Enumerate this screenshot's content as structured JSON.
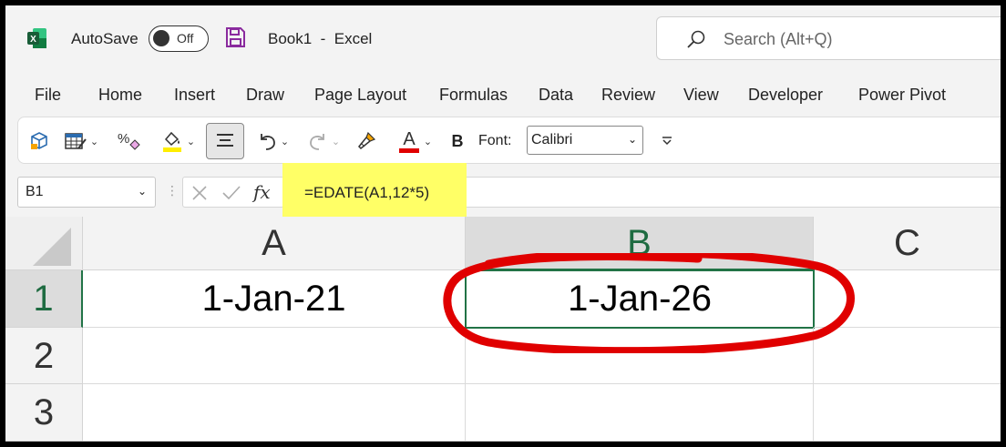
{
  "title_bar": {
    "autosave_label": "AutoSave",
    "autosave_state": "Off",
    "document_title": "Book1  -  Excel",
    "search_placeholder": "Search (Alt+Q)"
  },
  "menu": {
    "items": [
      "File",
      "Home",
      "Insert",
      "Draw",
      "Page Layout",
      "Formulas",
      "Data",
      "Review",
      "View",
      "Developer",
      "Power Pivot"
    ]
  },
  "ribbon": {
    "font_label": "Font:",
    "font_value": "Calibri",
    "bold_label": "B",
    "font_color_letter": "A",
    "icons": [
      "3d-models-icon",
      "format-as-table-icon",
      "percent-style-icon",
      "fill-color-icon",
      "align-center-icon",
      "undo-icon",
      "redo-icon",
      "format-painter-icon",
      "font-color-icon",
      "bold-icon",
      "customize-toolbar-icon"
    ],
    "colors": {
      "fill_color_bar": "#ffee00",
      "font_color_bar": "#e00000"
    }
  },
  "formula_bar": {
    "name_box": "B1",
    "fx_label": "fx",
    "formula": "=EDATE(A1,12*5)",
    "highlight_color": "#ffff66"
  },
  "grid": {
    "columns": [
      "A",
      "B",
      "C"
    ],
    "rows": [
      "1",
      "2",
      "3"
    ],
    "cells": {
      "A1": "1-Jan-21",
      "B1": "1-Jan-26"
    },
    "active_cell": "B1",
    "accent_color": "#217346",
    "annotation_color": "#e00000"
  }
}
